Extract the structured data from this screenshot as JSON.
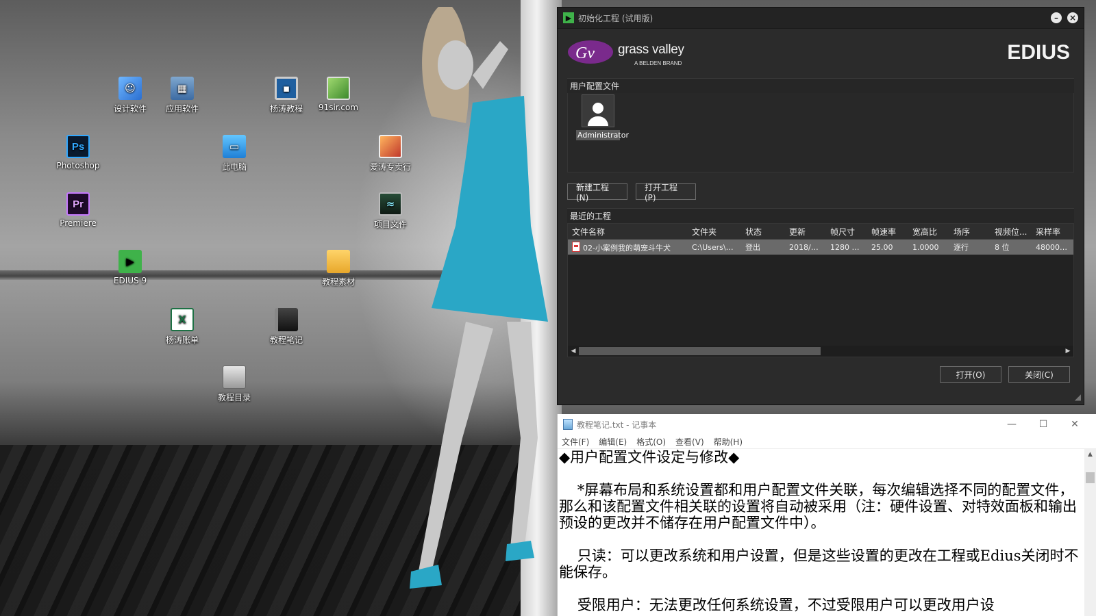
{
  "desktop": {
    "icons": [
      {
        "label": "设计软件",
        "icon": "finder-icon"
      },
      {
        "label": "应用软件",
        "icon": "apps-folder-icon"
      },
      {
        "label": "杨涛教程",
        "icon": "monitor-icon"
      },
      {
        "label": "91sir.com",
        "icon": "photo-icon"
      },
      {
        "label": "Photoshop",
        "icon": "photoshop-icon",
        "glyph": "Ps"
      },
      {
        "label": "此电脑",
        "icon": "this-pc-icon"
      },
      {
        "label": "爱涛专卖行",
        "icon": "pictures-icon"
      },
      {
        "label": "Premiere",
        "icon": "premiere-icon",
        "glyph": "Pr"
      },
      {
        "label": "项目文件",
        "icon": "project-icon"
      },
      {
        "label": "EDIUS 9",
        "icon": "edius-icon",
        "glyph": "▶"
      },
      {
        "label": "教程素材",
        "icon": "folder-icon"
      },
      {
        "label": "杨涛账单",
        "icon": "excel-icon",
        "glyph": "X"
      },
      {
        "label": "教程笔记",
        "icon": "notebook-icon"
      },
      {
        "label": "教程目录",
        "icon": "disk-icon"
      }
    ]
  },
  "edius": {
    "title": "初始化工程 (试用版)",
    "brand": {
      "gv_text": "grass valley",
      "gv_sub": "A BELDEN BRAND",
      "product": "EDIUS"
    },
    "profile_section": "用户配置文件",
    "profile_name": "Administrator",
    "buttons": {
      "new_project": "新建工程(N)",
      "open_project": "打开工程(P)",
      "open": "打开(O)",
      "close": "关闭(C)"
    },
    "recent_section": "最近的工程",
    "columns": [
      "文件名称",
      "文件夹",
      "状态",
      "更新",
      "帧尺寸",
      "帧速率",
      "宽高比",
      "场序",
      "视频位...",
      "采样率"
    ],
    "rows": [
      [
        "02-小案例我的萌宠斗牛犬",
        "C:\\Users\\A...",
        "登出",
        "2018/4/1...",
        "1280 x ...",
        "25.00",
        "1.0000",
        "逐行",
        "8 位",
        "48000Hz"
      ]
    ],
    "accent": "#3fb24a"
  },
  "notepad": {
    "title": "教程笔记.txt - 记事本",
    "menu": [
      "文件(F)",
      "编辑(E)",
      "格式(O)",
      "查看(V)",
      "帮助(H)"
    ],
    "content": "◆用户配置文件设定与修改◆\n\n    *屏幕布局和系统设置都和用户配置文件关联，每次编辑选择不同的配置文件，那么和该配置文件相关联的设置将自动被采用（注：硬件设置、对特效面板和输出预设的更改并不储存在用户配置文件中）。\n\n    只读：可以更改系统和用户设置，但是这些设置的更改在工程或Edius关闭时不能保存。\n\n    受限用户：无法更改任何系统设置，不过受限用户可以更改用户设"
  }
}
